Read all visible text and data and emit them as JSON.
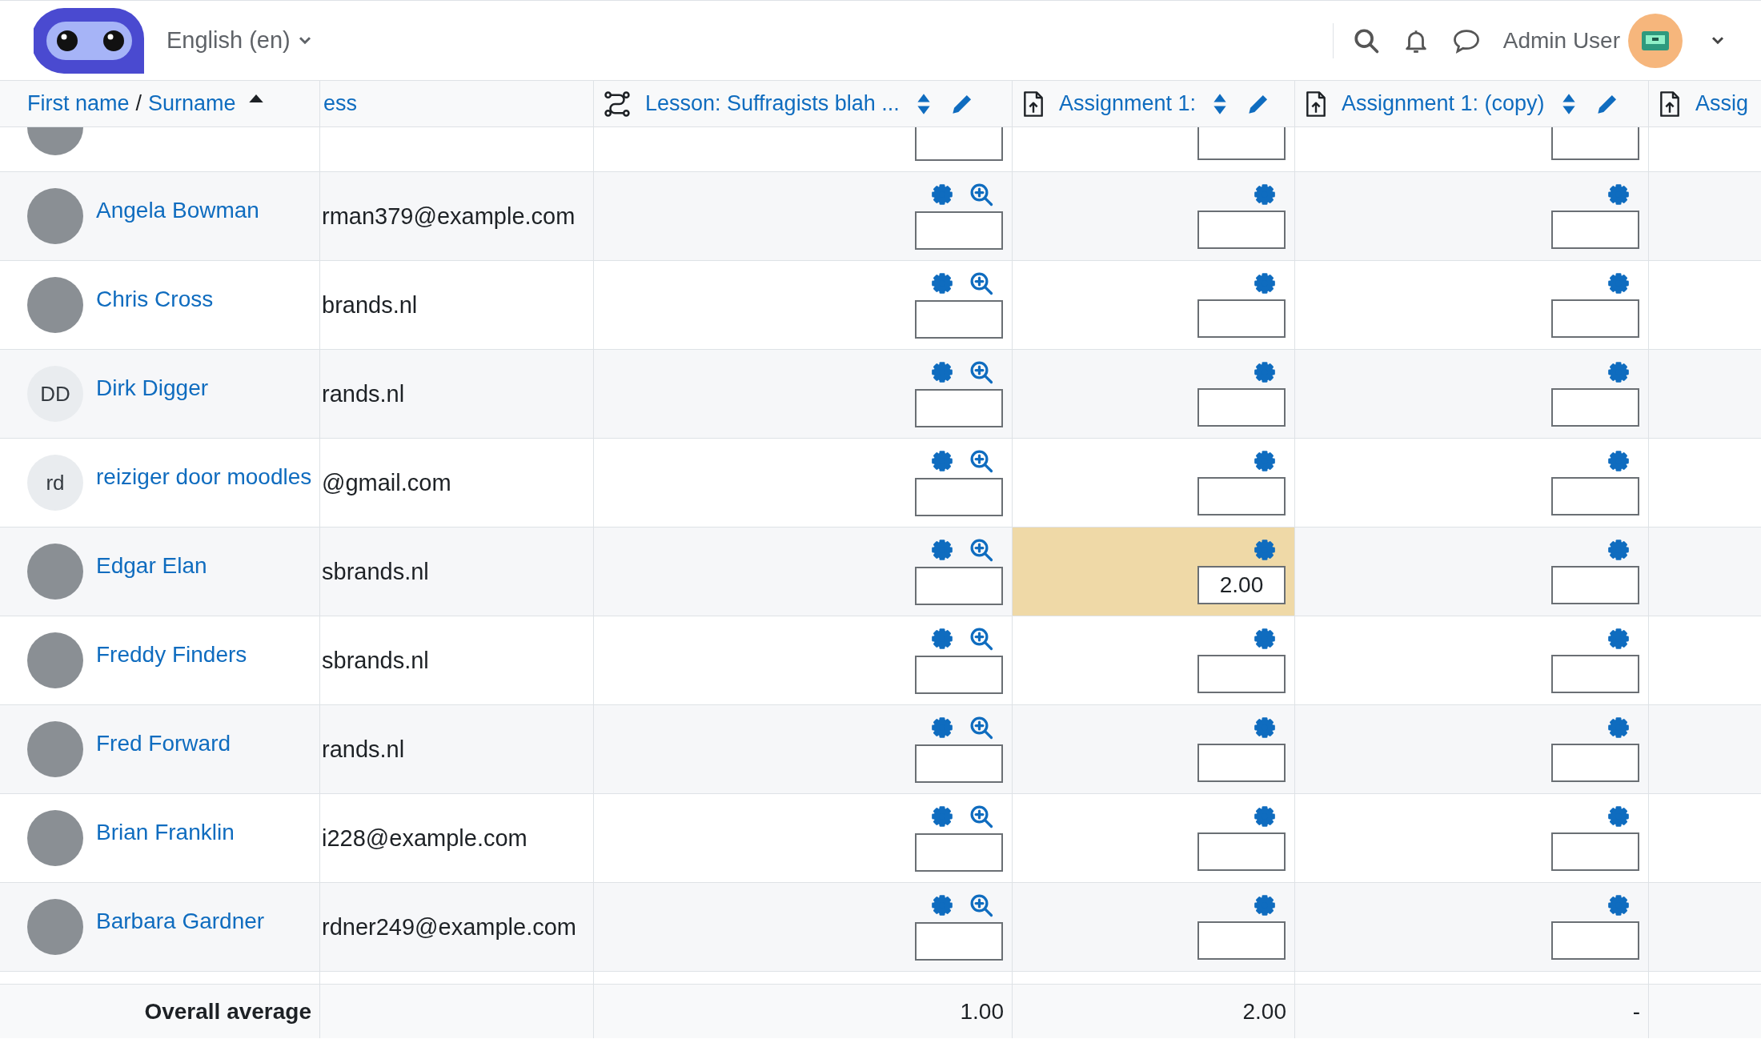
{
  "navbar": {
    "language": "English (en)",
    "user_name": "Admin User"
  },
  "name_column": {
    "first_label": "First name",
    "separator": "/",
    "second_label": "Surname",
    "sorted_ascending": true
  },
  "email_column": {
    "label": "ess"
  },
  "grade_items": [
    {
      "kind": "lesson",
      "label": "Lesson: Suffragists blah ...",
      "sortable": true,
      "editable": true,
      "analysis": true
    },
    {
      "kind": "assignment",
      "label": "Assignment 1:",
      "sortable": true,
      "editable": true,
      "analysis": false
    },
    {
      "kind": "assignment",
      "label": "Assignment 1: (copy)",
      "sortable": true,
      "editable": true,
      "analysis": false
    },
    {
      "kind": "assignment",
      "label": "Assig",
      "sortable": false,
      "editable": false,
      "analysis": false
    }
  ],
  "partial_row": {
    "avatar": {
      "kind": "photo"
    },
    "grades": [
      {
        "highlighted": false
      },
      {
        "highlighted": false
      },
      {
        "highlighted": false
      }
    ]
  },
  "rows": [
    {
      "avatar": {
        "kind": "photo"
      },
      "name": "Angela Bowman",
      "email": "rman379@example.com",
      "grades": [
        {
          "highlighted": false
        },
        {
          "highlighted": false
        },
        {
          "highlighted": false
        }
      ]
    },
    {
      "avatar": {
        "kind": "photo"
      },
      "name": "Chris Cross",
      "email": "brands.nl",
      "grades": [
        {
          "highlighted": false
        },
        {
          "highlighted": false
        },
        {
          "highlighted": false
        }
      ]
    },
    {
      "avatar": {
        "kind": "initials",
        "text": "DD"
      },
      "name": "Dirk Digger",
      "email": "rands.nl",
      "grades": [
        {
          "highlighted": false
        },
        {
          "highlighted": false
        },
        {
          "highlighted": false
        }
      ]
    },
    {
      "avatar": {
        "kind": "initials",
        "text": "rd"
      },
      "name": "reiziger door moodles",
      "email": "@gmail.com",
      "grades": [
        {
          "highlighted": false
        },
        {
          "highlighted": false
        },
        {
          "highlighted": false
        }
      ]
    },
    {
      "avatar": {
        "kind": "photo"
      },
      "name": "Edgar Elan",
      "email": "sbrands.nl",
      "grades": [
        {
          "highlighted": false
        },
        {
          "highlighted": true,
          "value": "2.00"
        },
        {
          "highlighted": false
        }
      ]
    },
    {
      "avatar": {
        "kind": "photo"
      },
      "name": "Freddy Finders",
      "email": "sbrands.nl",
      "grades": [
        {
          "highlighted": false
        },
        {
          "highlighted": false
        },
        {
          "highlighted": false
        }
      ]
    },
    {
      "avatar": {
        "kind": "photo"
      },
      "name": "Fred Forward",
      "email": "rands.nl",
      "grades": [
        {
          "highlighted": false
        },
        {
          "highlighted": false
        },
        {
          "highlighted": false
        }
      ]
    },
    {
      "avatar": {
        "kind": "photo"
      },
      "name": "Brian Franklin",
      "email": "i228@example.com",
      "grades": [
        {
          "highlighted": false
        },
        {
          "highlighted": false
        },
        {
          "highlighted": false
        }
      ]
    },
    {
      "avatar": {
        "kind": "photo"
      },
      "name": "Barbara Gardner",
      "email": "rdner249@example.com",
      "grades": [
        {
          "highlighted": false
        },
        {
          "highlighted": false
        },
        {
          "highlighted": false
        }
      ]
    }
  ],
  "footer": {
    "label": "Overall average",
    "averages": [
      "1.00",
      "2.00",
      "-"
    ]
  }
}
